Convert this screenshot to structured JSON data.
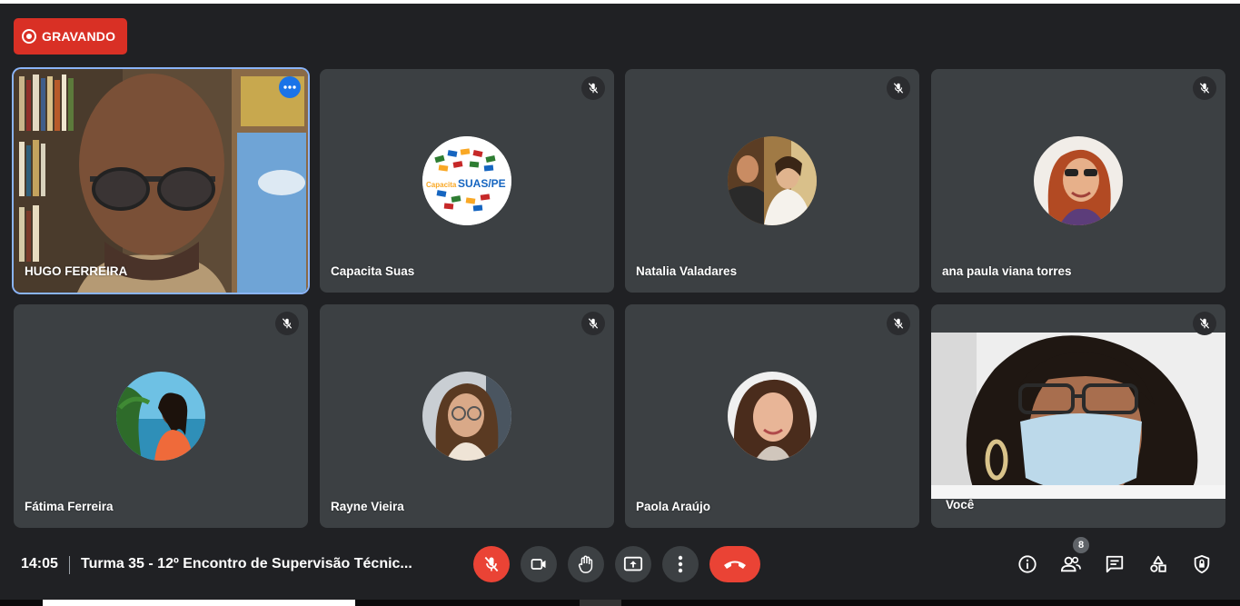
{
  "recording": {
    "label": "GRAVANDO",
    "color": "#d93025"
  },
  "participants": [
    {
      "name": "HUGO FERREIRA",
      "muted": false,
      "video": true
    },
    {
      "name": "Capacita Suas",
      "muted": true,
      "video": false
    },
    {
      "name": "Natalia Valadares",
      "muted": true,
      "video": false
    },
    {
      "name": "ana paula viana torres",
      "muted": true,
      "video": false
    },
    {
      "name": "Fátima Ferreira",
      "muted": true,
      "video": false
    },
    {
      "name": "Rayne Vieira",
      "muted": true,
      "video": false
    },
    {
      "name": "Paola Araújo",
      "muted": true,
      "video": false
    },
    {
      "name": "Você",
      "muted": true,
      "video": true
    }
  ],
  "logo": {
    "top": "Capacita",
    "bottom": "SUAS/PE"
  },
  "footer": {
    "time": "14:05",
    "meeting_title": "Turma 35 - 12º Encontro de Supervisão Técnic...",
    "participants_count": "8"
  },
  "icons": {
    "record": "record-icon",
    "more": "more-options-icon",
    "mic_off": "mic-off-icon",
    "camera": "camera-icon",
    "hand": "raise-hand-icon",
    "present": "present-screen-icon",
    "more_vert": "more-vert-icon",
    "hangup": "hang-up-icon",
    "info": "info-icon",
    "people": "people-icon",
    "chat": "chat-icon",
    "activities": "activities-icon",
    "host_controls": "host-controls-icon"
  },
  "colors": {
    "background": "#202124",
    "tile": "#3c4043",
    "active_border": "#8ab4f8",
    "danger": "#ea4335",
    "accent": "#1a73e8"
  }
}
